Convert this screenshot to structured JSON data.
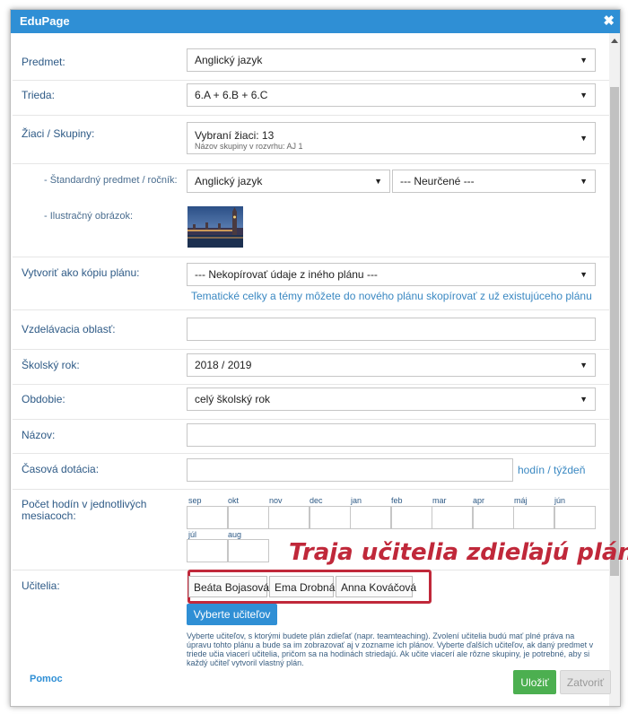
{
  "dialog": {
    "title": "EduPage",
    "close_glyph": "✖"
  },
  "fields": {
    "predmet": {
      "label": "Predmet:",
      "value": "Anglický jazyk"
    },
    "trieda": {
      "label": "Trieda:",
      "value": "6.A + 6.B + 6.C"
    },
    "ziaci": {
      "label": "Žiaci / Skupiny:",
      "value": "Vybraní žiaci: 13",
      "subvalue": "Názov skupiny v rozvrhu: AJ 1"
    },
    "standard": {
      "label": "- Štandardný predmet / ročník:",
      "value1": "Anglický jazyk",
      "value2": "--- Neurčené ---"
    },
    "obrazok": {
      "label": "- Ilustračný obrázok:"
    },
    "kopia": {
      "label": "Vytvoriť ako kópiu plánu:",
      "value": "--- Nekopírovať údaje z iného plánu ---",
      "hint": "Tematické celky a témy môžete do nového plánu skopírovať z už existujúceho plánu"
    },
    "oblast": {
      "label": "Vzdelávacia oblasť:",
      "value": ""
    },
    "rok": {
      "label": "Školský rok:",
      "value": "2018 / 2019"
    },
    "obdobie": {
      "label": "Obdobie:",
      "value": "celý školský rok"
    },
    "nazov": {
      "label": "Názov:",
      "value": ""
    },
    "dotacia": {
      "label": "Časová dotácia:",
      "value": "",
      "unit": "hodín / týždeň"
    },
    "hodiny": {
      "label": "Počet hodín v jednotlivých mesiacoch:",
      "months": [
        "sep",
        "okt",
        "nov",
        "dec",
        "jan",
        "feb",
        "mar",
        "apr",
        "máj",
        "jún",
        "júl",
        "aug"
      ]
    },
    "ucitelia": {
      "label": "Učitelia:",
      "teachers": [
        "Beáta Bojasová",
        "Ema Drobná",
        "Anna Kováčová"
      ],
      "select_button": "Vyberte učiteľov",
      "note": "Vyberte učiteľov, s ktorými budete plán zdieľať (napr. teamteaching). Zvolení učitelia budú mať plné práva na úpravu tohto plánu a bude sa im zobrazovať aj v zozname ich plánov. Vyberte ďalších učiteľov, ak daný predmet v triede učia viacerí učitelia, pričom sa na hodinách striedajú. Ak učite viacerí ale rôzne skupiny, je potrebné, aby si každý učiteľ vytvoril vlastný plán."
    }
  },
  "annotation": "Traja učitelia zdieľajú plán",
  "footer": {
    "help": "Pomoc",
    "save": "Uložiť",
    "close": "Zatvoriť"
  },
  "colors": {
    "titlebar": "#2f8fd5",
    "label": "#2e5a86",
    "save": "#4caf50",
    "select_btn": "#2f8fd5",
    "annotation": "#c0283a"
  }
}
